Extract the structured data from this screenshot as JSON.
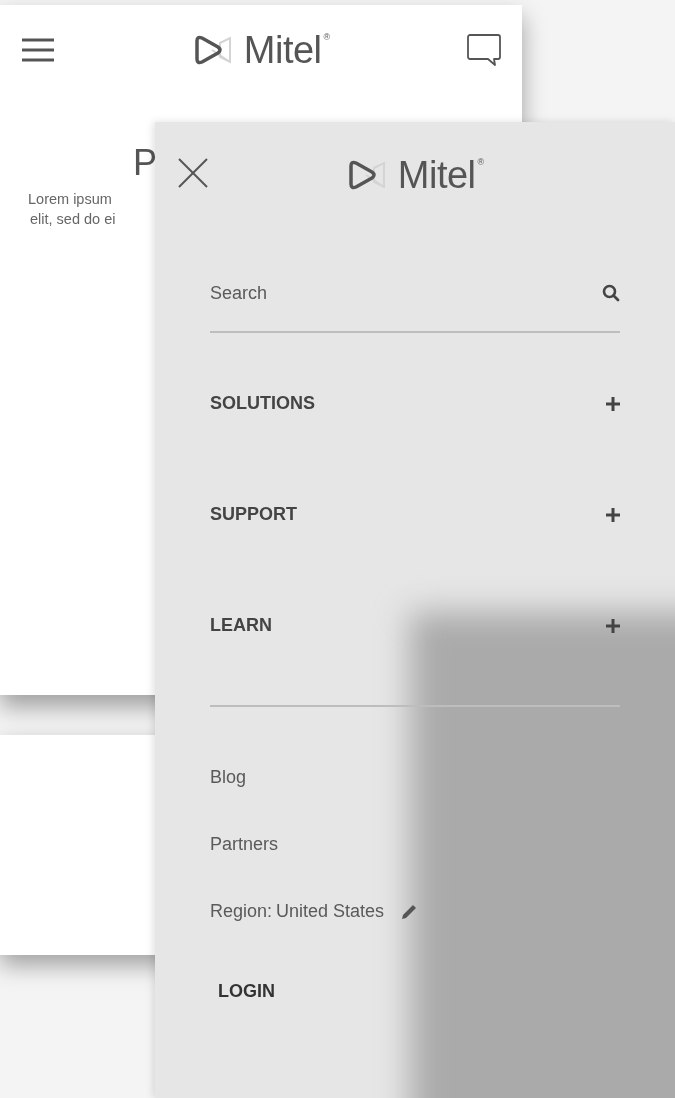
{
  "back_screen": {
    "header": {
      "logo": {
        "text": "Mitel",
        "mark": "®"
      }
    },
    "title": "P",
    "body_lines": [
      "Lorem ipsum",
      "elit, sed do ei"
    ]
  },
  "menu_panel": {
    "logo": {
      "text": "Mitel",
      "mark": "®"
    },
    "search": {
      "placeholder": "Search"
    },
    "sections": [
      {
        "label": "SOLUTIONS",
        "expanded": false
      },
      {
        "label": "SUPPORT",
        "expanded": false
      },
      {
        "label": "LEARN",
        "expanded": false
      }
    ],
    "links": [
      {
        "label": "Blog"
      },
      {
        "label": "Partners"
      }
    ],
    "region": {
      "label": "Region:",
      "value": "United States"
    },
    "login": "LOGIN"
  }
}
